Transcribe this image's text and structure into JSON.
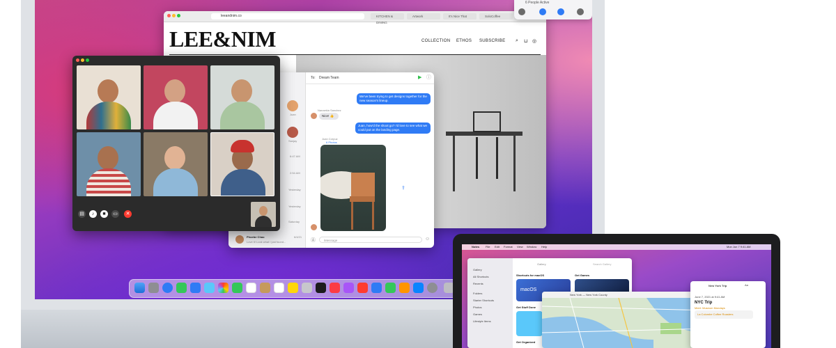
{
  "safari": {
    "url": "leeandnim.co",
    "tabs": [
      "KITCHEN & DINING",
      "Artwork",
      "It's Nice That",
      "SoloCoffee"
    ],
    "logo": "LEE&NIM",
    "nav": [
      "COLLECTION",
      "ETHOS",
      "SUBSCRIBE"
    ]
  },
  "shareplay": {
    "status": "6 People Active"
  },
  "messages": {
    "to_label": "To:",
    "recipient": "Dream Team",
    "bubble_1": "We've been trying to get designs together for the new season's lineup.",
    "sender_name": "Nanaekia Sanchez",
    "bubble_2": "Nice! 👍",
    "bubble_3": "Juan, how'd the shoot go? I'd love to see what we could put on the landing page.",
    "photo_sender": "Juan Corpuz",
    "photo_count": "6 Photos",
    "input_placeholder": "iMessage",
    "sidebar": [
      {
        "name": "Juan",
        "time": ""
      },
      {
        "name": "Sanjay",
        "time": ""
      }
    ],
    "times": [
      "6:47 AM",
      "2:54 AM",
      "Yesterday",
      "Yesterday",
      "Saturday"
    ],
    "last_chat": {
      "name": "Phoebe Chao",
      "time": "6/4/21",
      "preview": "Love it! Look what I just found..."
    }
  },
  "macbook": {
    "menubar": [
      "Notes",
      "File",
      "Edit",
      "Format",
      "View",
      "Window",
      "Help"
    ],
    "clock": "Mon Jun 7 9:41 AM",
    "gallery_title": "Gallery",
    "search_placeholder": "Search Gallery",
    "sections": [
      "Shortcuts for macOS",
      "Get Games",
      "Get Stuff Done",
      "Get Organized"
    ],
    "card_label": "macOS",
    "sidebar_items": [
      "Gallery",
      "All Shortcuts",
      "Recents",
      "Folders",
      "Starter Shortcuts",
      "Photos",
      "Games",
      "Lifestyle Items"
    ],
    "maps_title": "New York — New York County",
    "notes_title": "New York Trip",
    "notes_heading": "NYC Trip",
    "notes_sub": "Meet: Museum Mondays",
    "notes_date": "June 7, 2021 at 9:41 AM",
    "notes_link": "La Colombe Coffee Roasters"
  }
}
